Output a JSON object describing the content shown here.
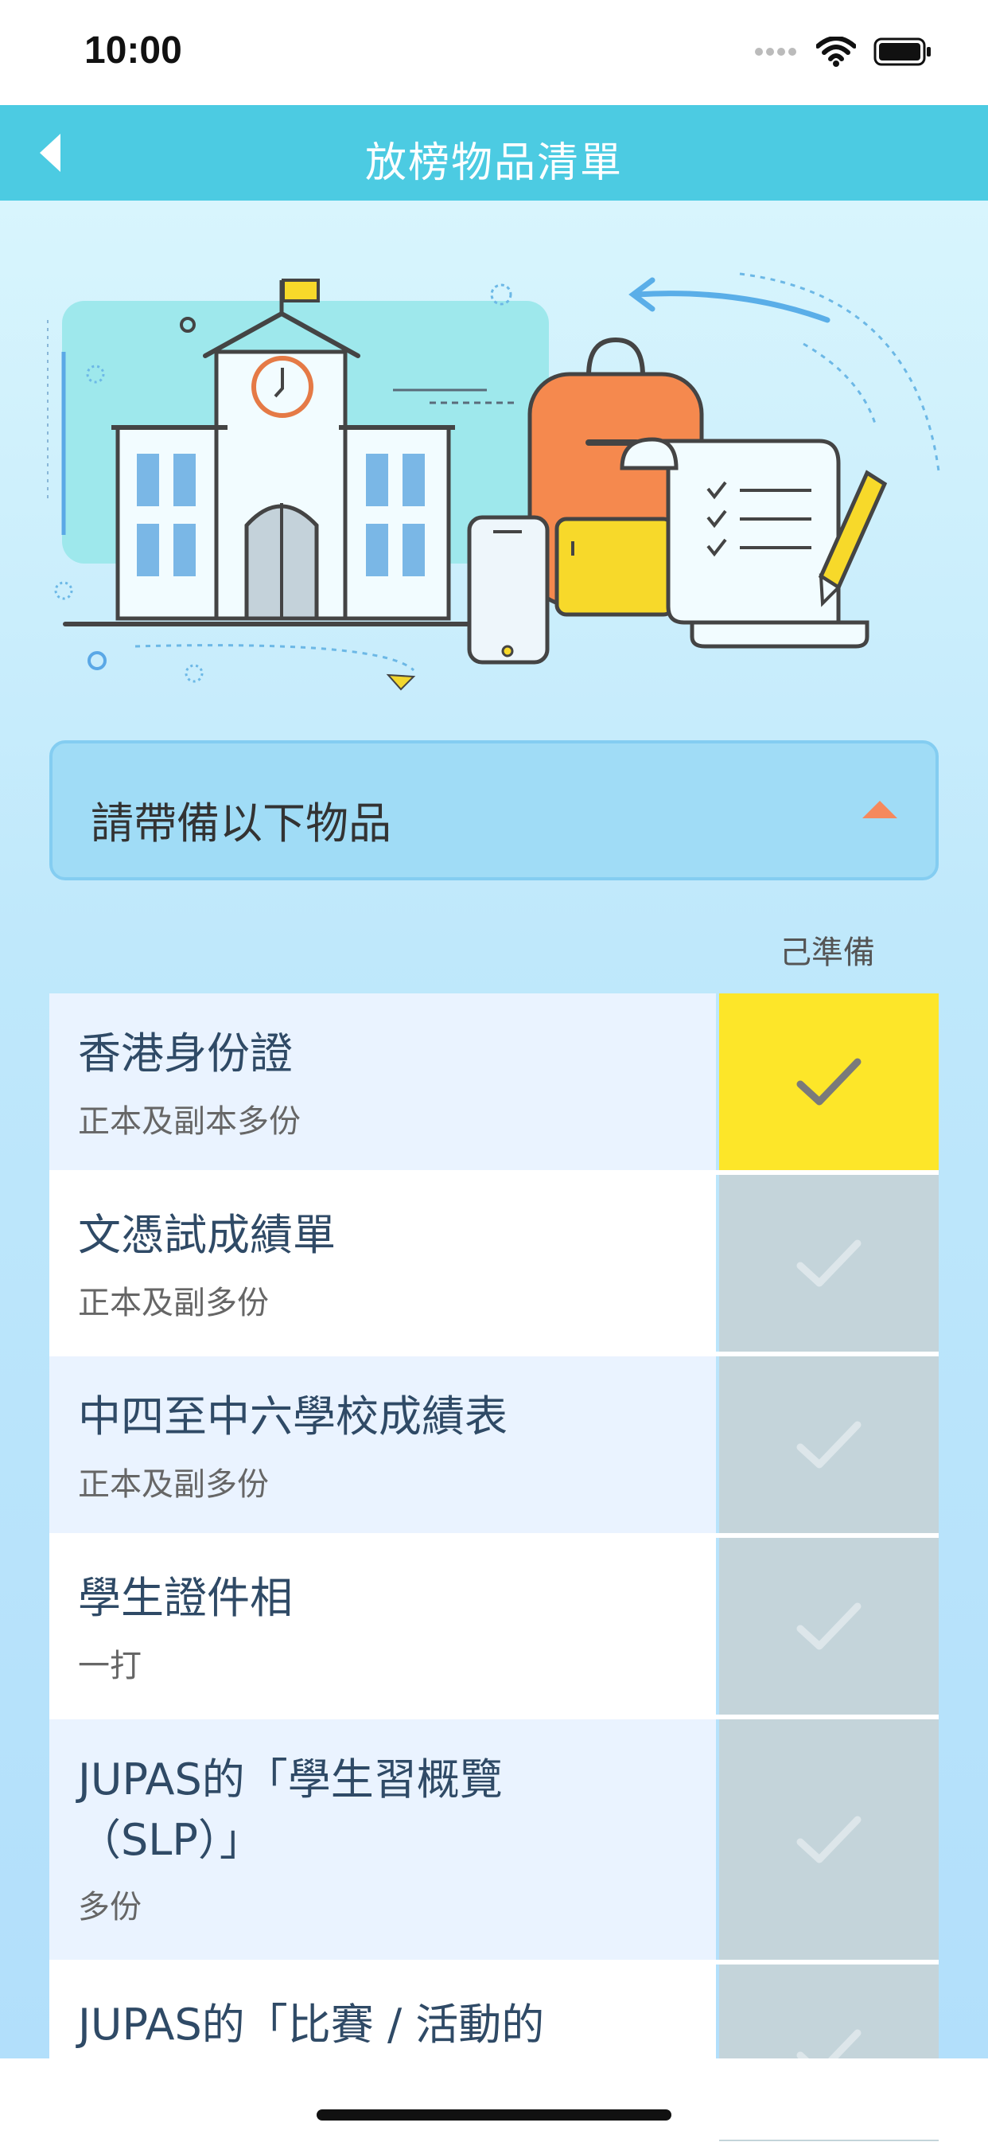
{
  "status_bar": {
    "time": "10:00"
  },
  "nav": {
    "title": "放榜物品清單"
  },
  "section": {
    "title": "請帶備以下物品"
  },
  "ready_label": "己準備",
  "items": [
    {
      "title": "香港身份證",
      "subtitle": "正本及副本多份",
      "checked": true
    },
    {
      "title": "文憑試成績單",
      "subtitle": "正本及副多份",
      "checked": false
    },
    {
      "title": "中四至中六學校成績表",
      "subtitle": "正本及副多份",
      "checked": false
    },
    {
      "title": "學生證件相",
      "subtitle": "一打",
      "checked": false
    },
    {
      "title": "JUPAS的「學生習概覽（SLP）」",
      "subtitle": "多份",
      "checked": false
    },
    {
      "title": "JUPAS的「比賽 / 活動的經驗及",
      "subtitle": "",
      "checked": false
    }
  ],
  "colors": {
    "nav": "#4ccbe2",
    "checked": "#fde629",
    "unchecked": "#c4d4da",
    "caret": "#f5895d"
  }
}
